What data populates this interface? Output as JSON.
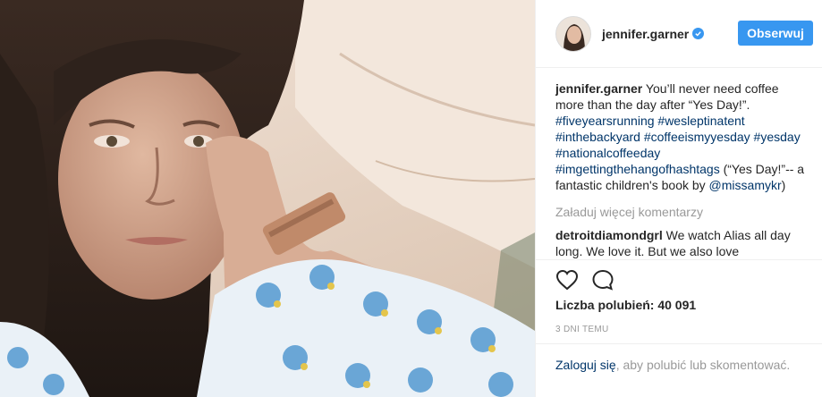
{
  "post": {
    "username": "jennifer.garner",
    "follow_label": "Obserwuj",
    "caption": {
      "author": "jennifer.garner",
      "text_before": "You’ll never need coffee more than the day after “Yes Day!”.",
      "hashtags": [
        "#fiveyearsrunning",
        "#wesleptinatent",
        "#inthebackyard",
        "#coffeeismyyesday",
        "#yesday",
        "#nationalcoffeeday",
        "#imgettingthehangofhashtags"
      ],
      "text_after": "(“Yes Day!”-- a fantastic children's book by",
      "mention": "@missamykr",
      "text_end": ")"
    },
    "load_more": "Załaduj więcej komentarzy",
    "comment": {
      "author": "detroitdiamondgrl",
      "text": "We watch Alias all day long. We love it. But we also love"
    },
    "likes_label": "Liczba polubień:",
    "likes_count": "40 091",
    "time_ago": "3 DNI TEMU",
    "footer": {
      "login": "Zaloguj się",
      "rest": ", aby polubić lub skomentować."
    }
  },
  "icons": {
    "like": "heart-icon",
    "comment": "comment-icon",
    "verified": "verified-badge-icon"
  }
}
